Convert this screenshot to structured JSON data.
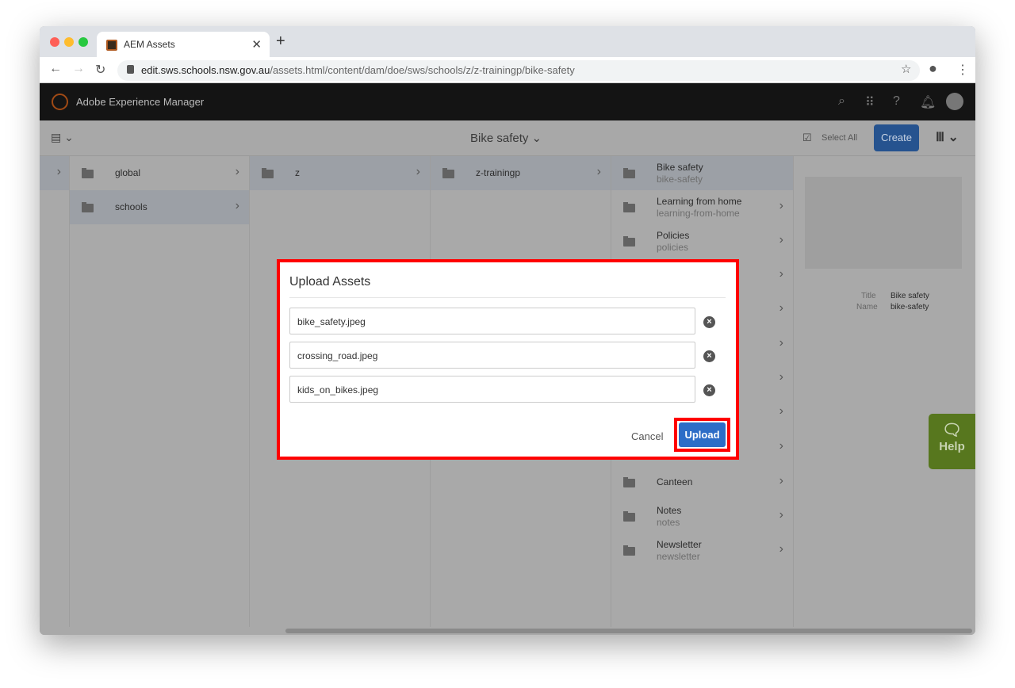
{
  "browser": {
    "tab_title": "AEM Assets",
    "url_host": "edit.sws.schools.nsw.gov.au",
    "url_path": "/assets.html/content/dam/doe/sws/schools/z/z-trainingp/bike-safety"
  },
  "header": {
    "app_name": "Adobe Experience Manager"
  },
  "toolbar": {
    "title": "Bike safety",
    "select_all": "Select All",
    "create": "Create"
  },
  "columns": {
    "col1": [
      {
        "label": "global",
        "selected": false
      },
      {
        "label": "schools",
        "selected": true
      }
    ],
    "col2": [
      {
        "label": "z",
        "selected": true
      }
    ],
    "col3": [
      {
        "label": "z-trainingp",
        "selected": true
      }
    ],
    "col4": [
      {
        "title": "Bike safety",
        "name": "bike-safety",
        "selected": true
      },
      {
        "title": "Learning from home",
        "name": "learning-from-home"
      },
      {
        "title": "Policies",
        "name": "policies"
      },
      {
        "title": "Canteen",
        "name": ""
      },
      {
        "title": "Notes",
        "name": "notes"
      },
      {
        "title": "Newsletter",
        "name": "newsletter"
      }
    ]
  },
  "preview": {
    "title_label": "Title",
    "title_value": "Bike safety",
    "name_label": "Name",
    "name_value": "bike-safety"
  },
  "help": {
    "label": "Help"
  },
  "dialog": {
    "title": "Upload Assets",
    "files": [
      "bike_safety.jpeg",
      "crossing_road.jpeg",
      "kids_on_bikes.jpeg"
    ],
    "cancel": "Cancel",
    "upload": "Upload"
  },
  "colors": {
    "create": "#26538f",
    "upload": "#2d6dc7",
    "highlight": "#ff0000",
    "help": "#57771e"
  }
}
